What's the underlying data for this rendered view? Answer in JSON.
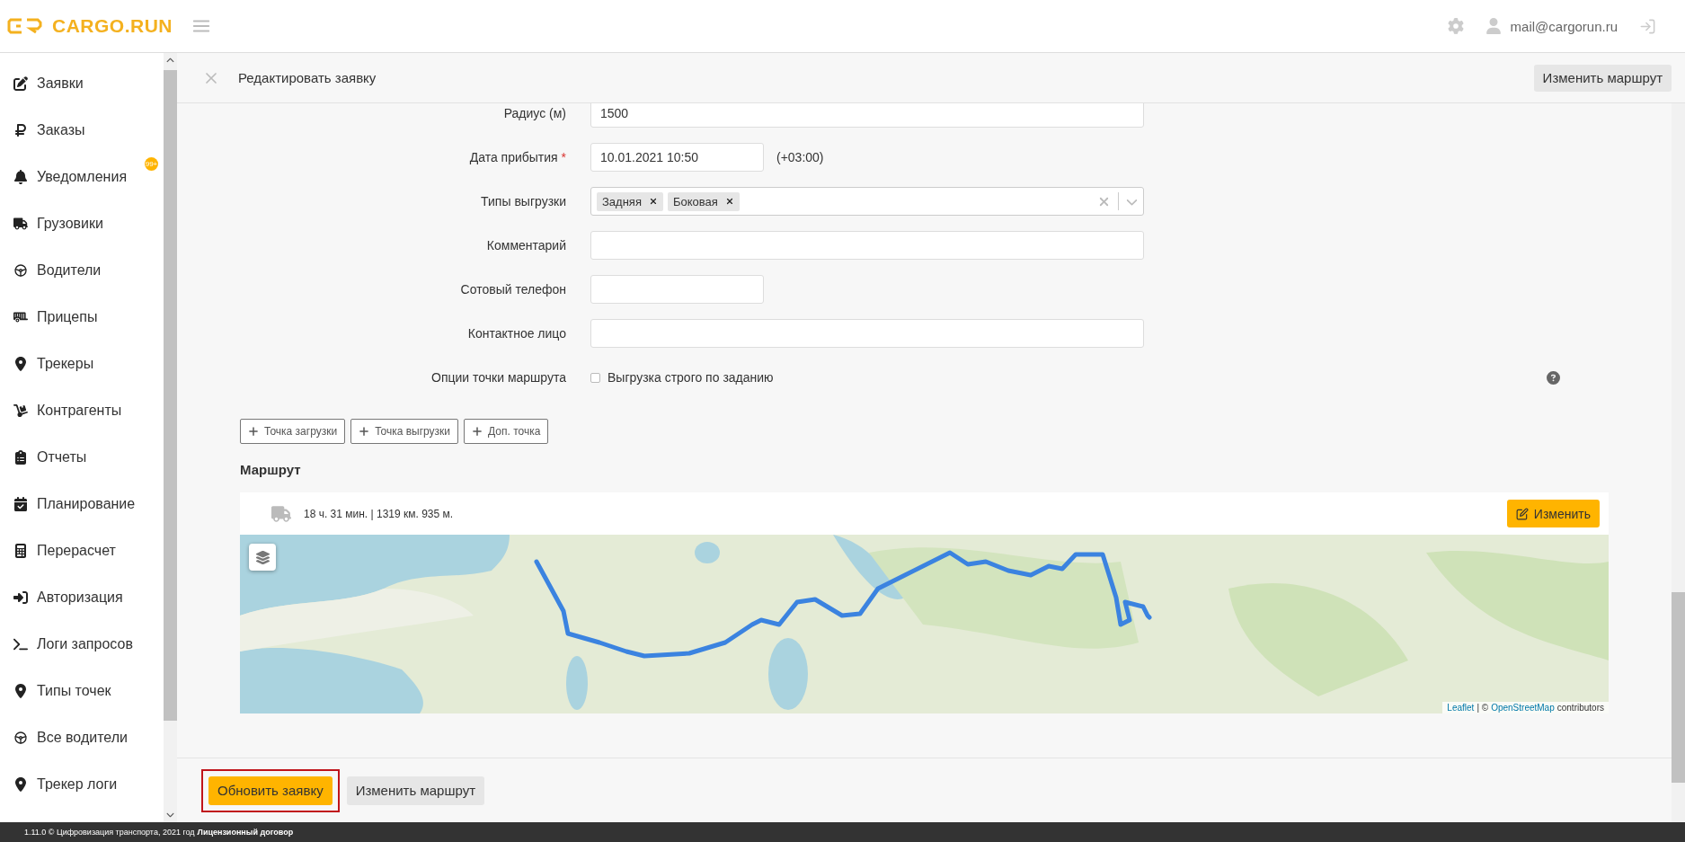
{
  "header": {
    "logo": "CARGO.RUN",
    "user_email": "mail@cargorun.ru"
  },
  "sidebar": {
    "items": [
      {
        "label": "Заявки"
      },
      {
        "label": "Заказы"
      },
      {
        "label": "Уведомления",
        "badge": "99+"
      },
      {
        "label": "Грузовики"
      },
      {
        "label": "Водители"
      },
      {
        "label": "Прицепы"
      },
      {
        "label": "Трекеры"
      },
      {
        "label": "Контрагенты"
      },
      {
        "label": "Отчеты"
      },
      {
        "label": "Планирование"
      },
      {
        "label": "Перерасчет"
      },
      {
        "label": "Авторизация"
      },
      {
        "label": "Логи запросов"
      },
      {
        "label": "Типы точек"
      },
      {
        "label": "Все водители"
      },
      {
        "label": "Трекер логи"
      }
    ]
  },
  "toolbar": {
    "title": "Редактировать заявку",
    "button": "Изменить маршрут"
  },
  "form": {
    "fields": [
      {
        "kind": "text",
        "label": "Радиус (м)",
        "value": "1500",
        "wide": true
      },
      {
        "kind": "text",
        "label": "Дата прибытия",
        "required_mark": "*",
        "value": "10.01.2021 10:50",
        "wide": false,
        "suffix": "(+03:00)"
      },
      {
        "kind": "tags",
        "label": "Типы выгрузки",
        "tags": [
          "Задняя",
          "Боковая"
        ]
      },
      {
        "kind": "text",
        "label": "Комментарий",
        "wide": true
      },
      {
        "kind": "text",
        "label": "Сотовый телефон",
        "wide": false
      },
      {
        "kind": "text",
        "label": "Контактное лицо",
        "wide": true
      },
      {
        "kind": "checkbox",
        "label": "Опции точки маршрута",
        "option": "Выгрузка строго по заданию",
        "checked": false
      }
    ]
  },
  "point_buttons": [
    "Точка загрузки",
    "Точка выгрузки",
    "Доп. точка"
  ],
  "route": {
    "title": "Маршрут",
    "summary": "18 ч. 31 мин. | 1319 км. 935 м.",
    "edit_button": "Изменить",
    "map": {
      "kind": "picture",
      "attribution": [
        {
          "text": "Leaflet",
          "link": true
        },
        {
          "text": "| ©",
          "link": false
        },
        {
          "text": "OpenStreetMap",
          "link": true
        },
        {
          "text": "contributors",
          "link": false
        }
      ]
    }
  },
  "actions": [
    {
      "label": "Обновить заявку",
      "primary": true,
      "highlighted": true
    },
    {
      "label": "Изменить маршрут",
      "primary": false,
      "highlighted": false
    }
  ],
  "footer": {
    "copyright": "1.11.0 © Цифровизация транспорта, 2021 год",
    "link": "Лицензионный договор"
  }
}
